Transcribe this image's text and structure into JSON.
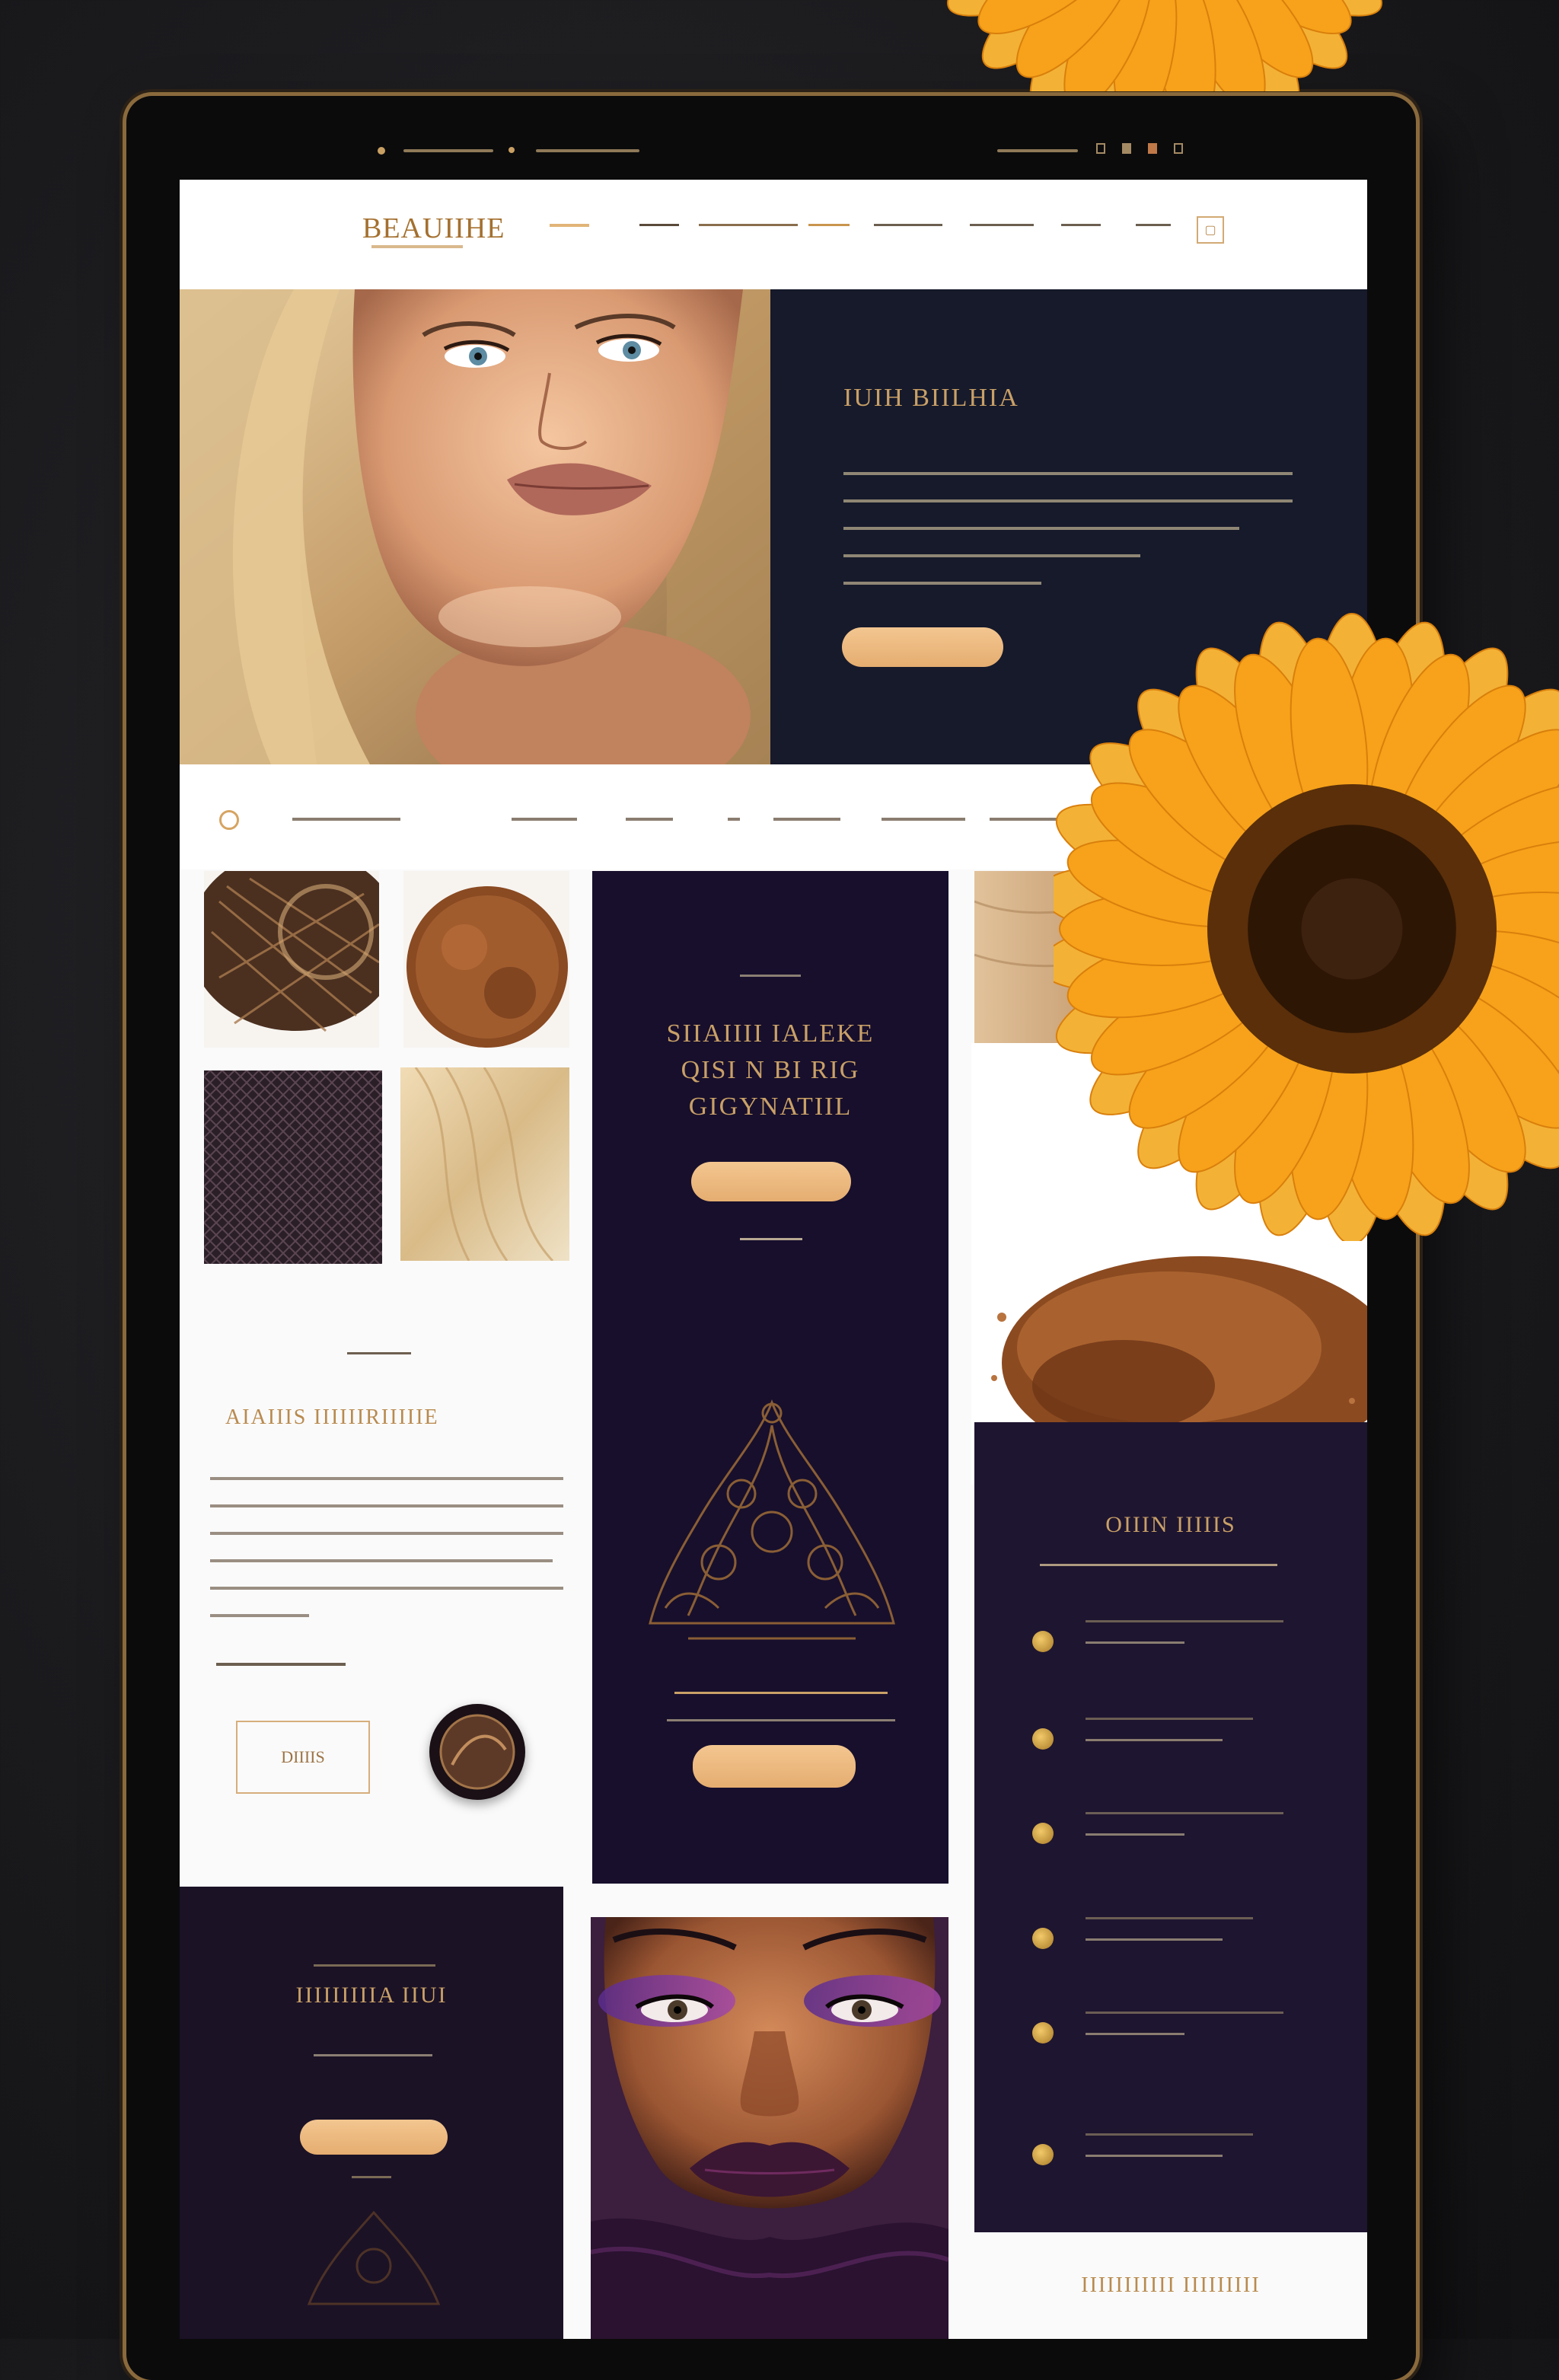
{
  "status_bar": {
    "right_text": ""
  },
  "nav": {
    "logo": "BEAUIIHE",
    "items": [
      "—",
      "",
      "",
      "",
      "",
      "",
      "",
      ""
    ],
    "icon": "square-icon"
  },
  "hero": {
    "title": "IUIH BIILHIA",
    "paragraph_lines": [
      "",
      "",
      "",
      "",
      ""
    ],
    "button_label": ""
  },
  "subnav": {
    "items": [
      "",
      "",
      "",
      "",
      "",
      "",
      ""
    ]
  },
  "promo_card": {
    "kicker": "",
    "title_lines": [
      "SIIAIIII IALEKE",
      "QISI N BI RIG",
      "GIGYNATIIL"
    ],
    "button_label": "",
    "caption": "",
    "bottom_text": "",
    "bottom_button_label": ""
  },
  "about": {
    "kicker": "",
    "title": "AIAIIIS IIIIIIRIIIIIE",
    "paragraph_lines": [
      "",
      "",
      "",
      "",
      "",
      ""
    ],
    "link_text": "",
    "outline_button_label": "DIIIIS"
  },
  "features_card": {
    "title": "OIIIN IIIIIS",
    "subtitle": "",
    "items": [
      "",
      "",
      "",
      "",
      "",
      ""
    ]
  },
  "bottom_card": {
    "title": "IIIIIIIIIA IIUI",
    "sub": "",
    "button_label": ""
  },
  "footer_title": "IIIIIIIIIII IIIIIIIII",
  "colors": {
    "gold": "#c9a067",
    "navy": "#161a2b",
    "purple": "#170f2c",
    "button": "#ecb97e"
  }
}
